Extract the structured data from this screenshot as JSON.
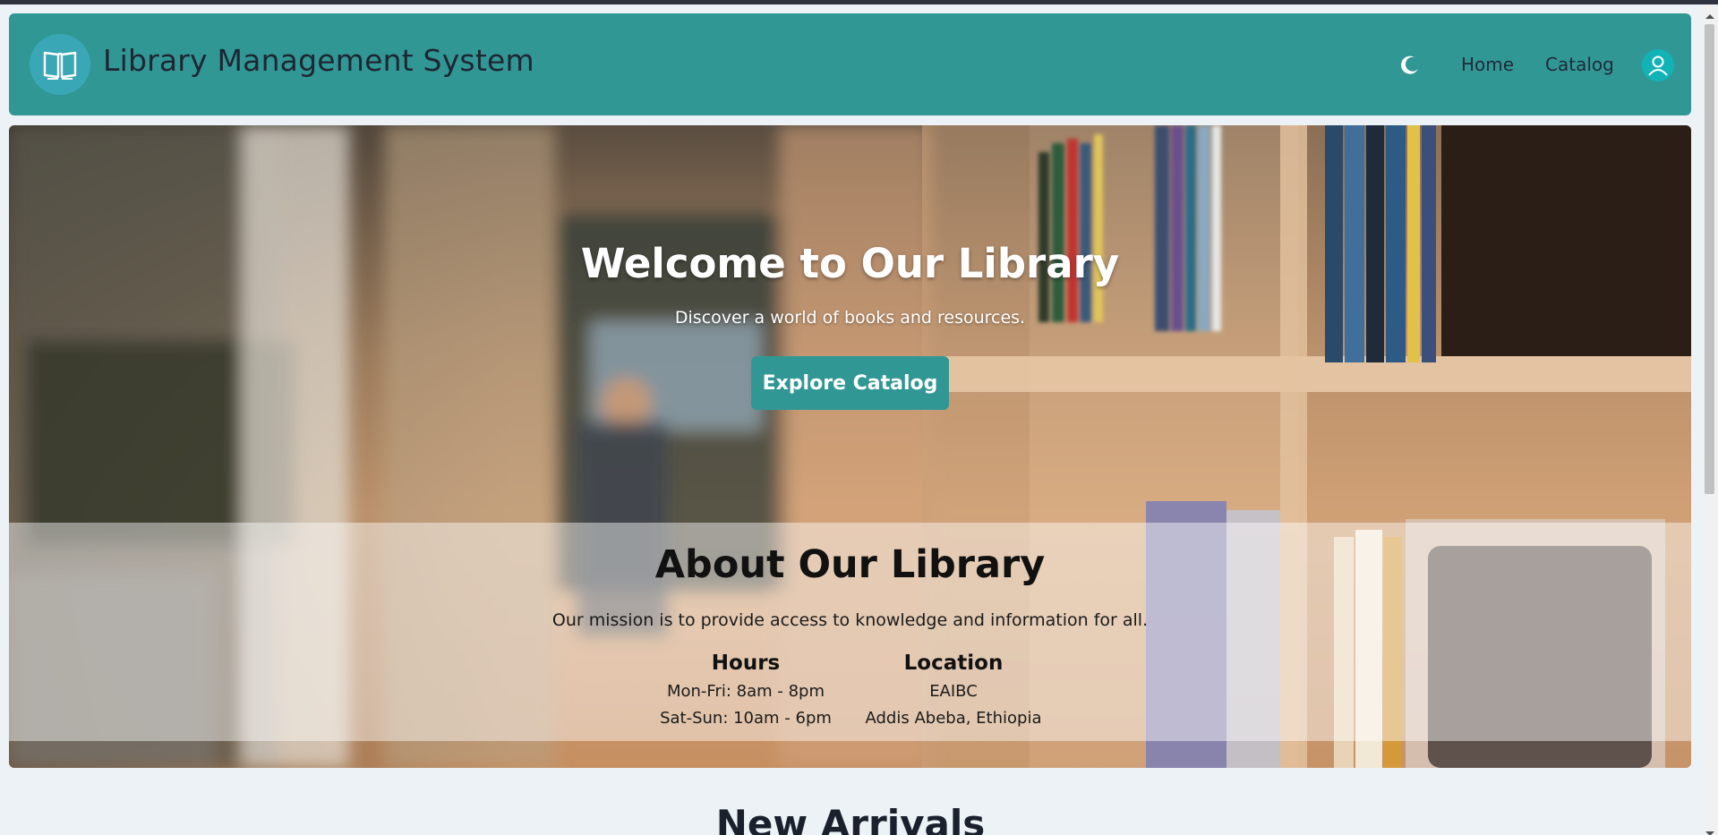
{
  "header": {
    "title": "Library Management System",
    "logo_icon": "open-book-icon",
    "theme_icon": "moon-icon",
    "nav": [
      {
        "label": "Home"
      },
      {
        "label": "Catalog"
      }
    ],
    "account_icon": "user-icon",
    "colors": {
      "bar": "#319795",
      "logo_bg": "#3aa7b6",
      "avatar_bg": "#12b3b7"
    }
  },
  "hero": {
    "title": "Welcome to Our Library",
    "subtitle": "Discover a world of books and resources.",
    "cta_label": "Explore Catalog"
  },
  "about": {
    "title": "About Our Library",
    "mission": "Our mission is to provide access to knowledge and information for all.",
    "hours": {
      "heading": "Hours",
      "lines": [
        "Mon-Fri: 8am - 8pm",
        "Sat-Sun: 10am - 6pm"
      ]
    },
    "location": {
      "heading": "Location",
      "lines": [
        "EAIBC",
        "Addis Abeba, Ethiopia"
      ]
    }
  },
  "sections": {
    "new_arrivals_title": "New Arrivals"
  }
}
